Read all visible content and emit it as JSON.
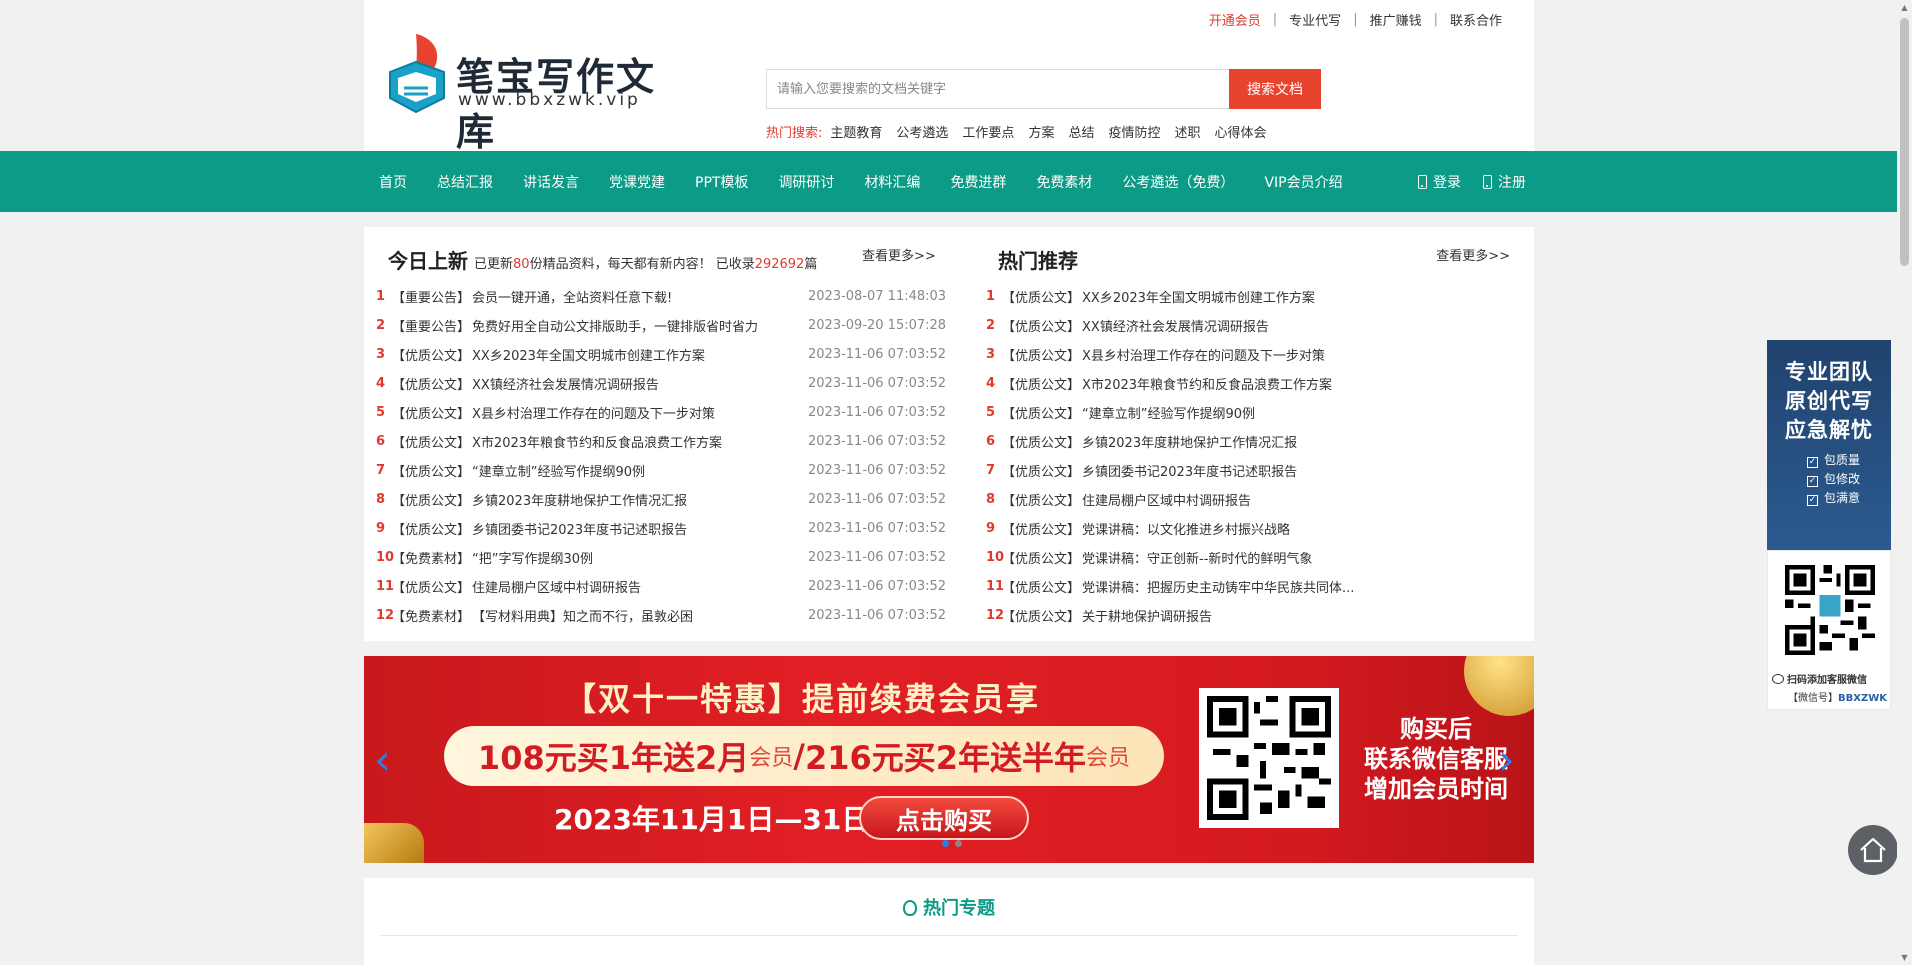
{
  "header": {
    "top_links": [
      {
        "label": "开通会员",
        "highlight": true
      },
      {
        "label": "专业代写"
      },
      {
        "label": "推广赚钱"
      },
      {
        "label": "联系合作"
      }
    ],
    "logo": {
      "name": "笔宝写作文库",
      "url": "www.bbxzwk.vip"
    },
    "search": {
      "placeholder": "请输入您要搜索的文档关键字",
      "button": "搜索文档"
    },
    "hot_search": {
      "label": "热门搜索:",
      "items": [
        "主题教育",
        "公考遴选",
        "工作要点",
        "方案",
        "总结",
        "疫情防控",
        "述职",
        "心得体会"
      ]
    }
  },
  "nav": {
    "items": [
      "首页",
      "总结汇报",
      "讲话发言",
      "党课党建",
      "PPT模板",
      "调研研讨",
      "材料汇编",
      "免费进群",
      "免费素材",
      "公考遴选（免费）",
      "VIP会员介绍"
    ],
    "login": "登录",
    "register": "注册"
  },
  "today": {
    "title": "今日上新",
    "sub_prefix": "已更新",
    "updated_count": "80",
    "sub_middle": "份精品资料，每天都有新内容！ 已收录",
    "total_count": "292692",
    "sub_suffix": "篇",
    "more": "查看更多>>",
    "items": [
      {
        "num": "1",
        "tag": "【重要公告】",
        "title": "会员一键开通，全站资料任意下载!",
        "date": "2023-08-07 11:48:03"
      },
      {
        "num": "2",
        "tag": "【重要公告】",
        "title": "免费好用全自动公文排版助手，一键排版省时省力",
        "date": "2023-09-20 15:07:28"
      },
      {
        "num": "3",
        "tag": "【优质公文】",
        "title": "XX乡2023年全国文明城市创建工作方案",
        "date": "2023-11-06 07:03:52"
      },
      {
        "num": "4",
        "tag": "【优质公文】",
        "title": "XX镇经济社会发展情况调研报告",
        "date": "2023-11-06 07:03:52"
      },
      {
        "num": "5",
        "tag": "【优质公文】",
        "title": "X县乡村治理工作存在的问题及下一步对策",
        "date": "2023-11-06 07:03:52"
      },
      {
        "num": "6",
        "tag": "【优质公文】",
        "title": "X市2023年粮食节约和反食品浪费工作方案",
        "date": "2023-11-06 07:03:52"
      },
      {
        "num": "7",
        "tag": "【优质公文】",
        "title": "“建章立制”经验写作提纲90例",
        "date": "2023-11-06 07:03:52"
      },
      {
        "num": "8",
        "tag": "【优质公文】",
        "title": "乡镇2023年度耕地保护工作情况汇报",
        "date": "2023-11-06 07:03:52"
      },
      {
        "num": "9",
        "tag": "【优质公文】",
        "title": "乡镇团委书记2023年度书记述职报告",
        "date": "2023-11-06 07:03:52"
      },
      {
        "num": "10",
        "tag": "【免费素材】",
        "title": "“把”字写作提纲30例",
        "date": "2023-11-06 07:03:52"
      },
      {
        "num": "11",
        "tag": "【优质公文】",
        "title": "住建局棚户区域中村调研报告",
        "date": "2023-11-06 07:03:52"
      },
      {
        "num": "12",
        "tag": "【免费素材】",
        "title": "【写材料用典】知之而不行，虽敦必困",
        "date": "2023-11-06 07:03:52"
      }
    ]
  },
  "hot": {
    "title": "热门推荐",
    "more": "查看更多>>",
    "items": [
      {
        "num": "1",
        "tag": "【优质公文】",
        "title": "XX乡2023年全国文明城市创建工作方案"
      },
      {
        "num": "2",
        "tag": "【优质公文】",
        "title": "XX镇经济社会发展情况调研报告"
      },
      {
        "num": "3",
        "tag": "【优质公文】",
        "title": "X县乡村治理工作存在的问题及下一步对策"
      },
      {
        "num": "4",
        "tag": "【优质公文】",
        "title": "X市2023年粮食节约和反食品浪费工作方案"
      },
      {
        "num": "5",
        "tag": "【优质公文】",
        "title": "“建章立制”经验写作提纲90例"
      },
      {
        "num": "6",
        "tag": "【优质公文】",
        "title": "乡镇2023年度耕地保护工作情况汇报"
      },
      {
        "num": "7",
        "tag": "【优质公文】",
        "title": "乡镇团委书记2023年度书记述职报告"
      },
      {
        "num": "8",
        "tag": "【优质公文】",
        "title": "住建局棚户区域中村调研报告"
      },
      {
        "num": "9",
        "tag": "【优质公文】",
        "title": "党课讲稿：以文化推进乡村振兴战略"
      },
      {
        "num": "10",
        "tag": "【优质公文】",
        "title": "党课讲稿：守正创新--新时代的鲜明气象"
      },
      {
        "num": "11",
        "tag": "【优质公文】",
        "title": "党课讲稿：把握历史主动铸牢中华民族共同体..."
      },
      {
        "num": "12",
        "tag": "【优质公文】",
        "title": "关于耕地保护调研报告"
      }
    ]
  },
  "banner": {
    "title": "【双十一特惠】提前续费会员享",
    "offer1": "108元买1年送2月",
    "offer_unit": "会员",
    "offer_sep": "/",
    "offer2": "216元买2年送半年",
    "date": "2023年11月1日—31日",
    "buy": "点击购买",
    "side_lines": [
      "购买后",
      "联系微信客服",
      "增加会员时间"
    ]
  },
  "topics": {
    "title": "热门专题"
  },
  "float": {
    "lines": [
      "专业团队",
      "原创代写",
      "应急解忧"
    ],
    "checks": [
      "包质量",
      "包修改",
      "包满意"
    ],
    "scan_text": "扫码添加客服微信",
    "wechat_label": "【微信号】",
    "wechat_id": "BBXZWK"
  },
  "colors": {
    "teal": "#0b9b86",
    "red": "#e03a2f",
    "search_btn": "#e8432f"
  }
}
